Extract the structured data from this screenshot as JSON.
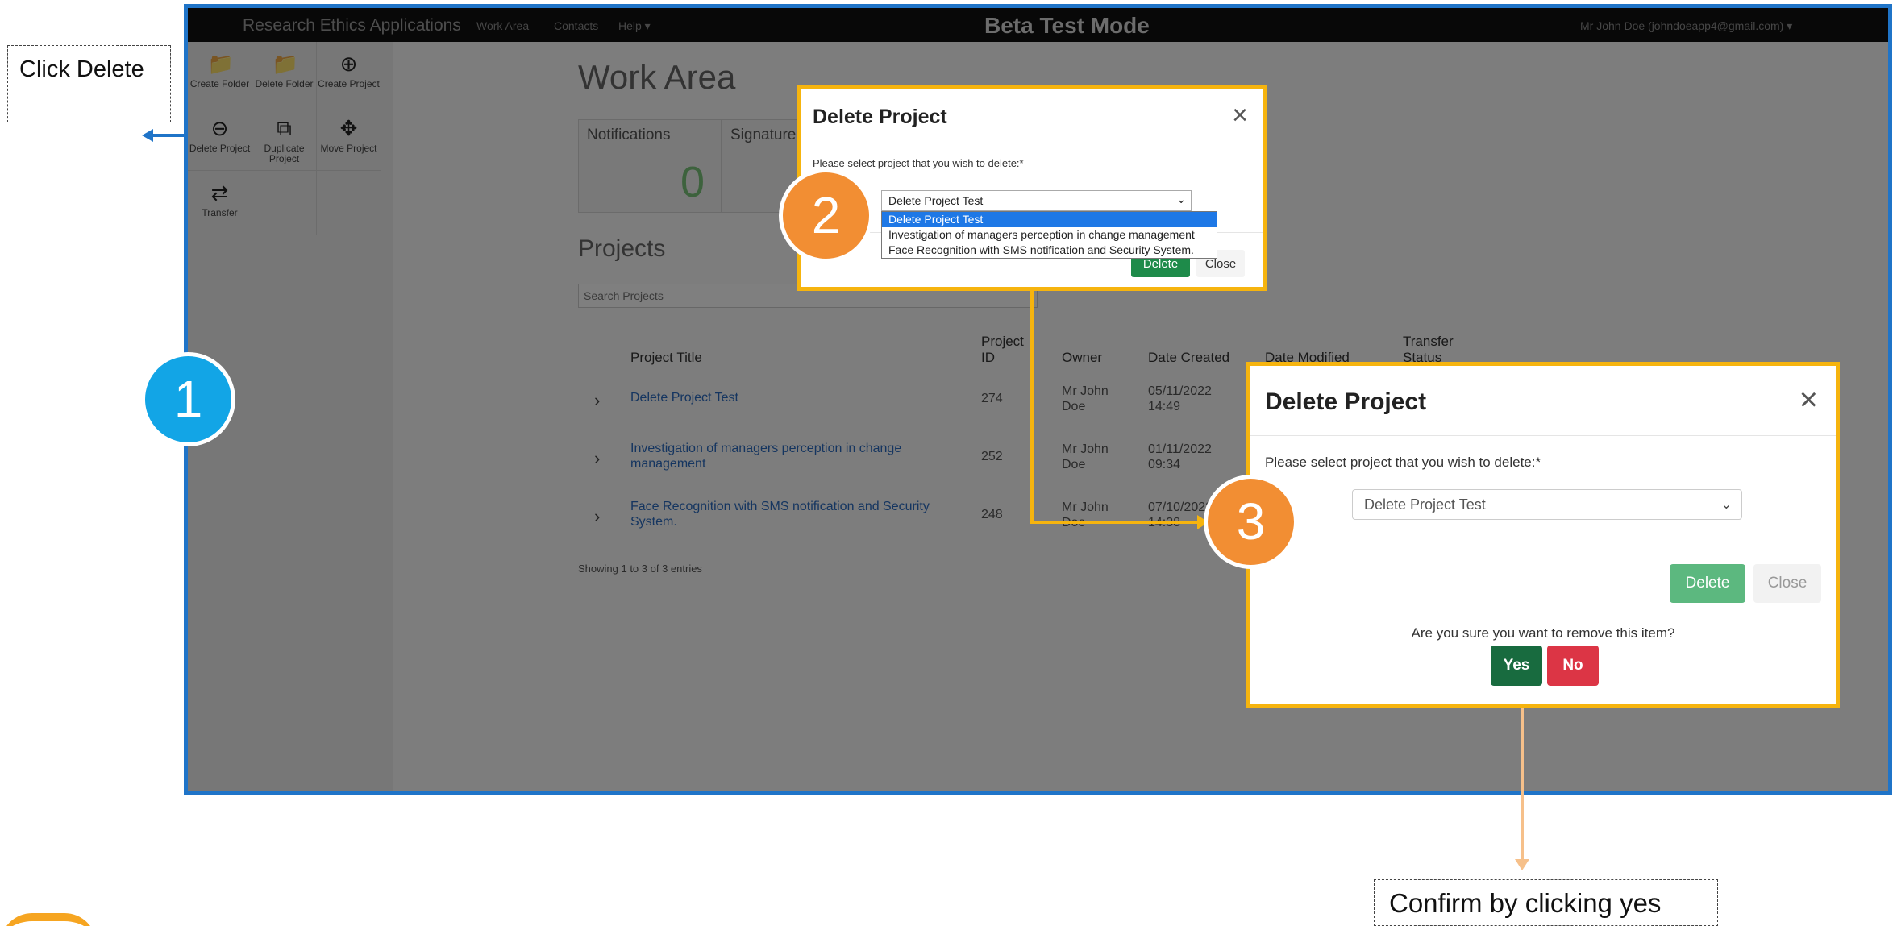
{
  "app": {
    "brand": "Research Ethics Applications",
    "nav": [
      "Work Area",
      "Contacts",
      "Help ▾"
    ],
    "beta": "Beta Test Mode",
    "user": "Mr John Doe (johndoeapp4@gmail.com) ▾"
  },
  "sidebar": {
    "tools": [
      {
        "label": "Create Folder",
        "icon": "folder-plus-icon",
        "glyph": "📁"
      },
      {
        "label": "Delete Folder",
        "icon": "folder-minus-icon",
        "glyph": "📁"
      },
      {
        "label": "Create Project",
        "icon": "plus-circle-icon",
        "glyph": "⊕"
      },
      {
        "label": "Delete Project",
        "icon": "minus-circle-icon",
        "glyph": "⊖"
      },
      {
        "label": "Duplicate Project",
        "icon": "duplicate-icon",
        "glyph": "⧉"
      },
      {
        "label": "Move Project",
        "icon": "move-icon",
        "glyph": "✥"
      },
      {
        "label": "Transfer",
        "icon": "transfer-icon",
        "glyph": "⇄"
      }
    ]
  },
  "main": {
    "title": "Work Area",
    "cards": [
      {
        "title": "Notifications",
        "value": "0"
      },
      {
        "title": "Signatures",
        "value": ""
      }
    ],
    "projects_heading": "Projects",
    "search_placeholder": "Search Projects",
    "columns": [
      "Project Title",
      "Project ID",
      "Owner",
      "Date Created",
      "Date Modified",
      "Transfer Status"
    ],
    "rows": [
      {
        "title": "Delete Project Test",
        "id": "274",
        "owner": "Mr John Doe",
        "created": "05/11/2022 14:49"
      },
      {
        "title": "Investigation of managers perception in change management",
        "id": "252",
        "owner": "Mr John Doe",
        "created": "01/11/2022 09:34"
      },
      {
        "title": "Face Recognition with SMS notification and Security System.",
        "id": "248",
        "owner": "Mr John Doe",
        "created": "07/10/2022 14:38"
      }
    ],
    "showing": "Showing 1 to 3 of 3 entries"
  },
  "dialog_small": {
    "title": "Delete Project",
    "prompt": "Please select project that you wish to delete:*",
    "selected": "Delete Project Test",
    "options": [
      "Delete Project Test",
      "Investigation of managers perception in change management",
      "Face Recognition with SMS notification and Security System."
    ],
    "delete_label": "Delete",
    "close_label": "Close"
  },
  "dialog_large": {
    "title": "Delete Project",
    "prompt": "Please select project that you wish to delete:*",
    "selected": "Delete Project Test",
    "delete_label": "Delete",
    "close_label": "Close",
    "confirm_text": "Are you sure you want to remove this item?",
    "yes_label": "Yes",
    "no_label": "No"
  },
  "annotations": {
    "step1": "1",
    "step2": "2",
    "step3": "3",
    "callout_click_delete": "Click Delete",
    "callout_confirm": "Confirm by clicking yes"
  },
  "colors": {
    "frame": "#1f74c8",
    "highlight": "#f6b40e",
    "step_blue": "#12a5e6",
    "step_orange": "#f28e33",
    "yes": "#186b3f",
    "no": "#dc3545"
  }
}
